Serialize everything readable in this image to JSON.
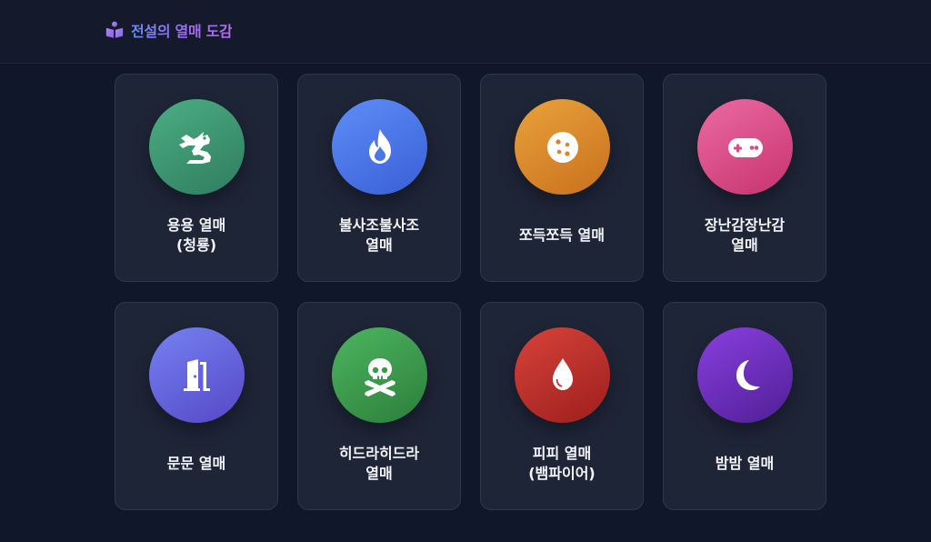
{
  "header": {
    "title": "전설의 열매 도감",
    "icon": "book-reader-icon"
  },
  "fruits": [
    {
      "line1": "용용 열매",
      "line2": "(청룡)",
      "icon": "dragon-icon",
      "colors": [
        "#4cae82",
        "#2e7d60"
      ]
    },
    {
      "line1": "불사조불사조",
      "line2": "열매",
      "icon": "fire-icon",
      "colors": [
        "#5d8ef7",
        "#3a5fd6"
      ]
    },
    {
      "line1": "쪼득쪼득 열매",
      "line2": "",
      "icon": "cookie-icon",
      "colors": [
        "#eba23a",
        "#c8701e"
      ]
    },
    {
      "line1": "장난감장난감",
      "line2": "열매",
      "icon": "gamepad-icon",
      "colors": [
        "#ec6aa3",
        "#c6346f"
      ]
    },
    {
      "line1": "문문 열매",
      "line2": "",
      "icon": "door-icon",
      "colors": [
        "#7483f0",
        "#5647c7"
      ]
    },
    {
      "line1": "히드라히드라",
      "line2": "열매",
      "icon": "skull-crossbones-icon",
      "colors": [
        "#4db561",
        "#2b7f3a"
      ]
    },
    {
      "line1": "피피 열매",
      "line2": "(뱀파이어)",
      "icon": "blood-drop-icon",
      "colors": [
        "#d6433a",
        "#9e1e1c"
      ]
    },
    {
      "line1": "밤밤 열매",
      "line2": "",
      "icon": "moon-icon",
      "colors": [
        "#8a3fe0",
        "#4f1f95"
      ]
    }
  ]
}
